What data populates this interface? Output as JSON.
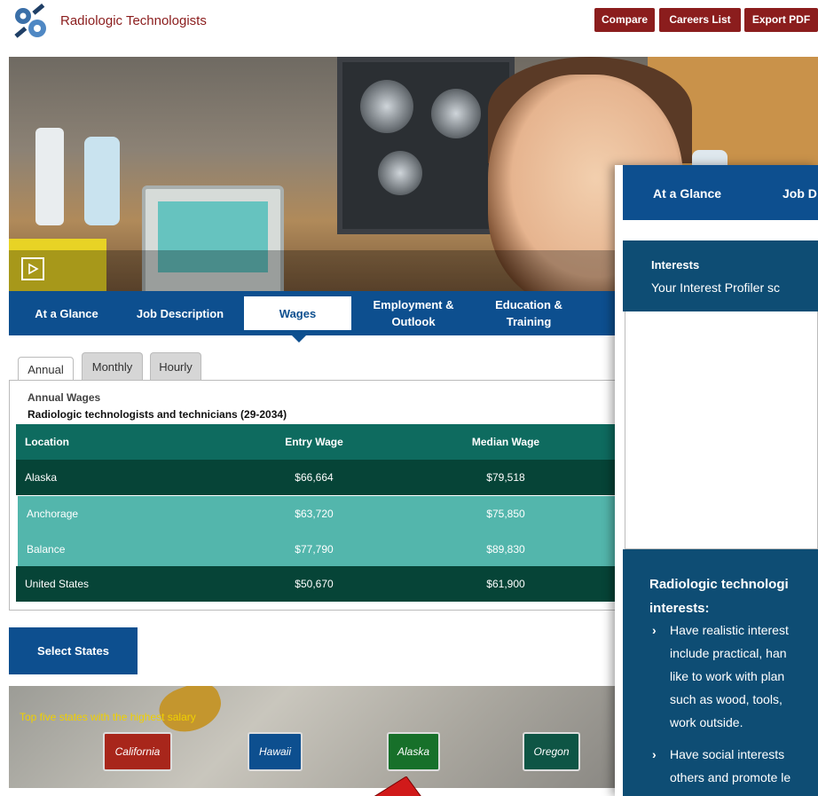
{
  "header": {
    "title": "Radiologic Technologists",
    "buttons": {
      "compare": "Compare",
      "careers_list": "Careers List",
      "export_pdf": "Export PDF"
    }
  },
  "nav_tabs": [
    {
      "label": "At a Glance"
    },
    {
      "label": "Job Description"
    },
    {
      "label": "Wages"
    },
    {
      "label": "Employment &\nOutlook"
    },
    {
      "label": "Education &\nTraining"
    }
  ],
  "active_tab": "Wages",
  "wage_tabs": [
    "Annual",
    "Monthly",
    "Hourly"
  ],
  "active_wage_tab": "Annual",
  "wages": {
    "title": "Annual Wages",
    "occupation": "Radiologic technologists and technicians (29-2034)",
    "columns": [
      "Location",
      "Entry Wage",
      "Median Wage"
    ],
    "rows": [
      {
        "location": "Alaska",
        "entry": "$66,664",
        "median": "$79,518"
      },
      {
        "location": "Anchorage",
        "entry": "$63,720",
        "median": "$75,850"
      },
      {
        "location": "Balance",
        "entry": "$77,790",
        "median": "$89,830"
      },
      {
        "location": "United States",
        "entry": "$50,670",
        "median": "$61,900"
      }
    ]
  },
  "select_states_label": "Select States",
  "map": {
    "caption": "Top five states with the highest salary",
    "states": [
      "California",
      "Hawaii",
      "Alaska",
      "Oregon"
    ]
  },
  "overlay": {
    "tabs": [
      "At a Glance",
      "Job D"
    ],
    "interests_title": "Interests",
    "interests_sub": "Your Interest Profiler sc",
    "heading_line1": "Radiologic technologi",
    "heading_line2": "interests:",
    "items": [
      [
        "Have realistic interest",
        "include practical, han",
        "like to work with plan",
        "such as wood, tools,",
        "work outside."
      ],
      [
        "Have social interests",
        "others and promote le"
      ]
    ]
  },
  "colors": {
    "brand_red": "#8b1d1d",
    "nav_blue": "#0d4f8f",
    "table_header": "#0e6b5f",
    "table_dark": "#064437",
    "table_light": "#53b6ac"
  }
}
